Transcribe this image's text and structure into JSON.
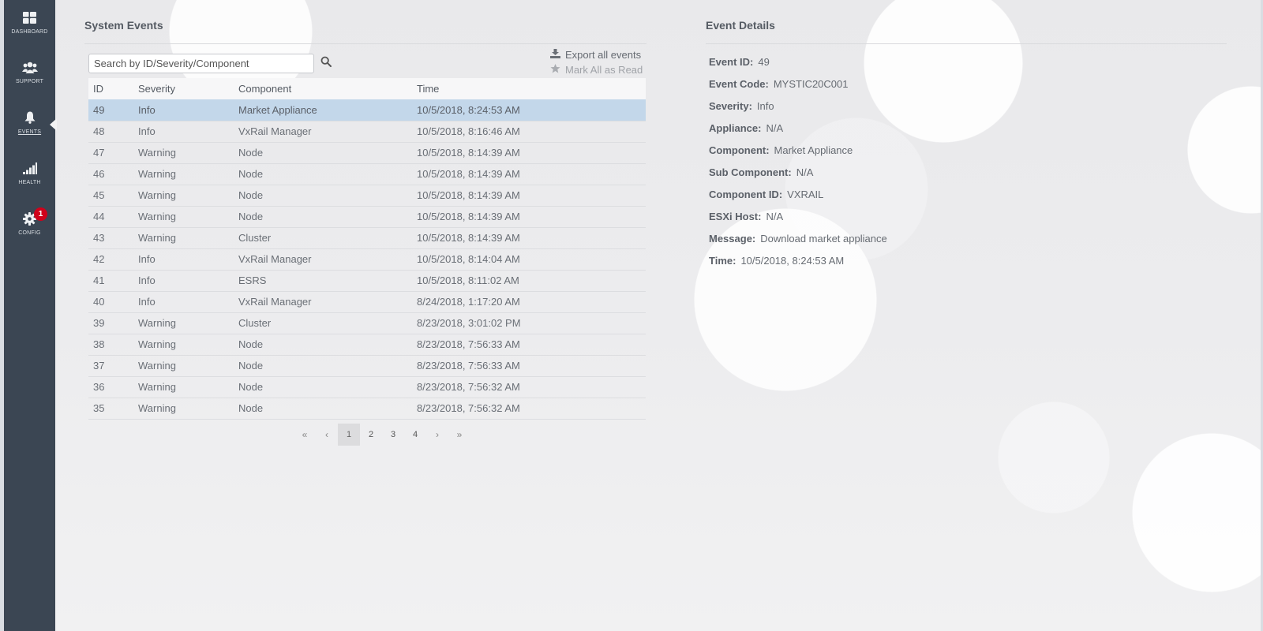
{
  "nav": [
    {
      "label": "DASHBOARD",
      "icon": "dashboard-icon"
    },
    {
      "label": "SUPPORT",
      "icon": "users-icon"
    },
    {
      "label": "EVENTS",
      "icon": "bell-icon",
      "active": true
    },
    {
      "label": "HEALTH",
      "icon": "signal-bars-icon"
    },
    {
      "label": "CONFIG",
      "icon": "gear-icon",
      "badge": "1"
    }
  ],
  "events_panel": {
    "title": "System Events",
    "search_placeholder": "Search by ID/Severity/Component",
    "export_label": "Export all events",
    "mark_read_label": "Mark All as Read",
    "columns": [
      "ID",
      "Severity",
      "Component",
      "Time"
    ],
    "rows": [
      {
        "id": "49",
        "severity": "Info",
        "component": "Market Appliance",
        "time": "10/5/2018, 8:24:53 AM",
        "selected": true
      },
      {
        "id": "48",
        "severity": "Info",
        "component": "VxRail Manager",
        "time": "10/5/2018, 8:16:46 AM"
      },
      {
        "id": "47",
        "severity": "Warning",
        "component": "Node",
        "time": "10/5/2018, 8:14:39 AM"
      },
      {
        "id": "46",
        "severity": "Warning",
        "component": "Node",
        "time": "10/5/2018, 8:14:39 AM"
      },
      {
        "id": "45",
        "severity": "Warning",
        "component": "Node",
        "time": "10/5/2018, 8:14:39 AM"
      },
      {
        "id": "44",
        "severity": "Warning",
        "component": "Node",
        "time": "10/5/2018, 8:14:39 AM"
      },
      {
        "id": "43",
        "severity": "Warning",
        "component": "Cluster",
        "time": "10/5/2018, 8:14:39 AM"
      },
      {
        "id": "42",
        "severity": "Info",
        "component": "VxRail Manager",
        "time": "10/5/2018, 8:14:04 AM"
      },
      {
        "id": "41",
        "severity": "Info",
        "component": "ESRS",
        "time": "10/5/2018, 8:11:02 AM"
      },
      {
        "id": "40",
        "severity": "Info",
        "component": "VxRail Manager",
        "time": "8/24/2018, 1:17:20 AM"
      },
      {
        "id": "39",
        "severity": "Warning",
        "component": "Cluster",
        "time": "8/23/2018, 3:01:02 PM"
      },
      {
        "id": "38",
        "severity": "Warning",
        "component": "Node",
        "time": "8/23/2018, 7:56:33 AM"
      },
      {
        "id": "37",
        "severity": "Warning",
        "component": "Node",
        "time": "8/23/2018, 7:56:33 AM"
      },
      {
        "id": "36",
        "severity": "Warning",
        "component": "Node",
        "time": "8/23/2018, 7:56:32 AM"
      },
      {
        "id": "35",
        "severity": "Warning",
        "component": "Node",
        "time": "8/23/2018, 7:56:32 AM"
      }
    ],
    "pagination": {
      "first": "«",
      "prev": "‹",
      "pages": [
        "1",
        "2",
        "3",
        "4"
      ],
      "current": "1",
      "next": "›",
      "last": "»"
    }
  },
  "details_panel": {
    "title": "Event Details",
    "fields": [
      {
        "key": "Event ID:",
        "value": "49"
      },
      {
        "key": "Event Code:",
        "value": "MYSTIC20C001"
      },
      {
        "key": "Severity:",
        "value": "Info"
      },
      {
        "key": "Appliance:",
        "value": "N/A"
      },
      {
        "key": "Component:",
        "value": "Market Appliance"
      },
      {
        "key": "Sub Component:",
        "value": "N/A"
      },
      {
        "key": "Component ID:",
        "value": "VXRAIL"
      },
      {
        "key": "ESXi Host:",
        "value": "N/A"
      },
      {
        "key": "Message:",
        "value": "Download market appliance"
      },
      {
        "key": "Time:",
        "value": "10/5/2018, 8:24:53 AM"
      }
    ]
  },
  "colors": {
    "sidebar": "#3b4653",
    "selected_row": "#c3d7ea",
    "badge": "#d0021b"
  }
}
